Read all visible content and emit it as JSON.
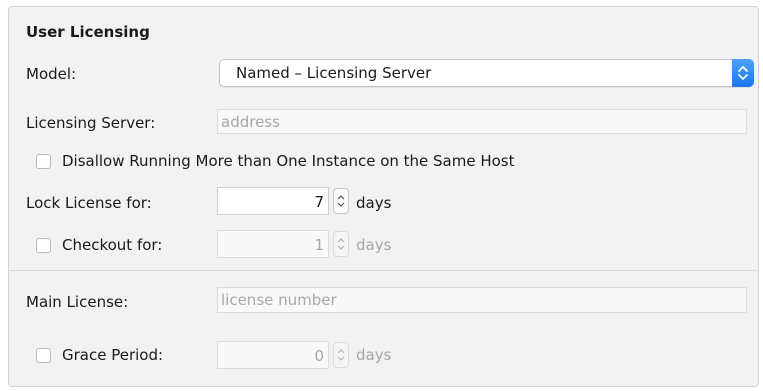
{
  "section": {
    "title": "User Licensing"
  },
  "model": {
    "label": "Model:",
    "selected": "Named – Licensing Server"
  },
  "licensing_server": {
    "label": "Licensing Server:",
    "placeholder": "address",
    "value": ""
  },
  "disallow_multiple": {
    "label": "Disallow Running More than One Instance on the Same Host",
    "checked": false
  },
  "lock_license": {
    "label": "Lock License for:",
    "value": "7",
    "unit": "days"
  },
  "checkout": {
    "label": "Checkout for:",
    "value": "1",
    "unit": "days",
    "checked": false
  },
  "main_license": {
    "label": "Main License:",
    "placeholder": "license number",
    "value": ""
  },
  "grace_period": {
    "label": "Grace Period:",
    "value": "0",
    "unit": "days",
    "checked": false
  },
  "colors": {
    "accent": "#1a76f2",
    "panel_bg": "#f2f2f2",
    "disabled_text": "#a6a6a6"
  },
  "icons": {
    "select_arrows": "up-down-chevron-icon",
    "stepper": "up-down-stepper-icon"
  }
}
